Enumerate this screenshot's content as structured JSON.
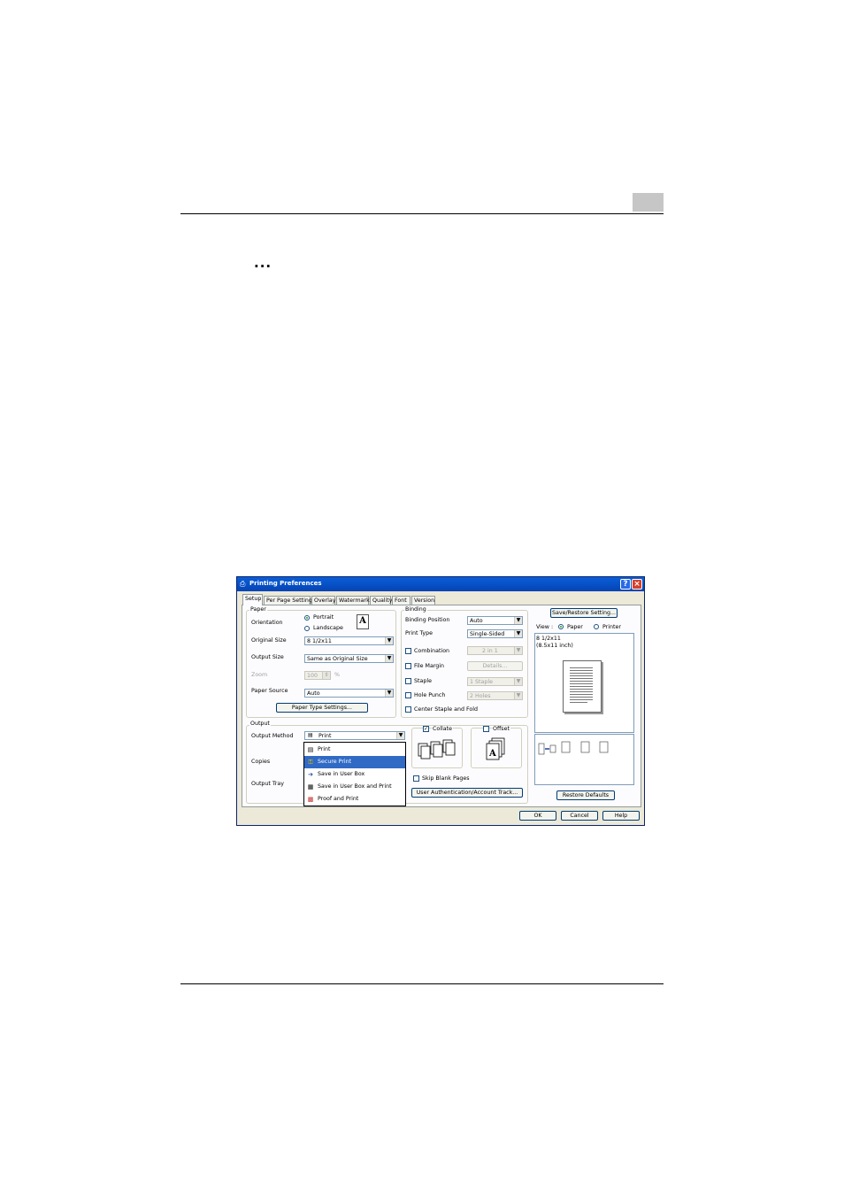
{
  "page": {
    "continuation_mark": "..."
  },
  "dialog": {
    "title": "Printing Preferences",
    "title_icon": "printer-icon",
    "tabs": [
      "Setup",
      "Per Page Setting",
      "Overlay",
      "Watermark",
      "Quality",
      "Font",
      "Version"
    ],
    "active_tab": "Setup",
    "paper": {
      "group_label": "Paper",
      "orientation_label": "Orientation",
      "portrait": "Portrait",
      "landscape": "Landscape",
      "orientation_selected": "Portrait",
      "orientation_glyph": "A",
      "original_size_label": "Original Size",
      "original_size_value": "8 1/2x11",
      "output_size_label": "Output Size",
      "output_size_value": "Same as Original Size",
      "zoom_label": "Zoom",
      "zoom_value": "100",
      "zoom_unit": "%",
      "paper_source_label": "Paper Source",
      "paper_source_value": "Auto",
      "paper_type_button": "Paper Type Settings..."
    },
    "binding": {
      "group_label": "Binding",
      "binding_position_label": "Binding Position",
      "binding_position_value": "Auto",
      "print_type_label": "Print Type",
      "print_type_value": "Single-Sided",
      "combination_label": "Combination",
      "combination_value": "2 in 1",
      "file_margin_label": "File Margin",
      "details_button": "Details...",
      "staple_label": "Staple",
      "staple_value": "1 Staple",
      "hole_punch_label": "Hole Punch",
      "hole_punch_value": "2 Holes",
      "center_staple_label": "Center Staple and Fold"
    },
    "output": {
      "group_label": "Output",
      "output_method_label": "Output Method",
      "output_method_value": "Print",
      "copies_label": "Copies",
      "output_tray_label": "Output Tray",
      "collate_label": "Collate",
      "collate_checked": true,
      "offset_label": "Offset",
      "offset_checked": false,
      "skip_blank_label": "Skip Blank Pages",
      "user_auth_button": "User Authentication/Account Track..."
    },
    "dropdown": {
      "items": [
        {
          "label": "Print",
          "icon": "page-icon"
        },
        {
          "label": "Secure Print",
          "icon": "key-icon"
        },
        {
          "label": "Save in User Box",
          "icon": "save-to-box-icon"
        },
        {
          "label": "Save in User Box and Print",
          "icon": "save-and-print-icon"
        },
        {
          "label": "Proof and Print",
          "icon": "proof-icon"
        }
      ],
      "selected": "Secure Print"
    },
    "right_panel": {
      "save_restore_button": "Save/Restore Setting...",
      "view_label": "View :",
      "view_paper": "Paper",
      "view_printer": "Printer",
      "view_selected": "Paper",
      "paper_size_line1": "8 1/2x11",
      "paper_size_line2": "(8.5x11 inch)",
      "restore_defaults_button": "Restore Defaults"
    },
    "footer": {
      "ok": "OK",
      "cancel": "Cancel",
      "help": "Help"
    },
    "colors": {
      "titlebar": "#0a5fd8",
      "selection": "#316ac5",
      "dialog_bg": "#ece9d8"
    }
  }
}
